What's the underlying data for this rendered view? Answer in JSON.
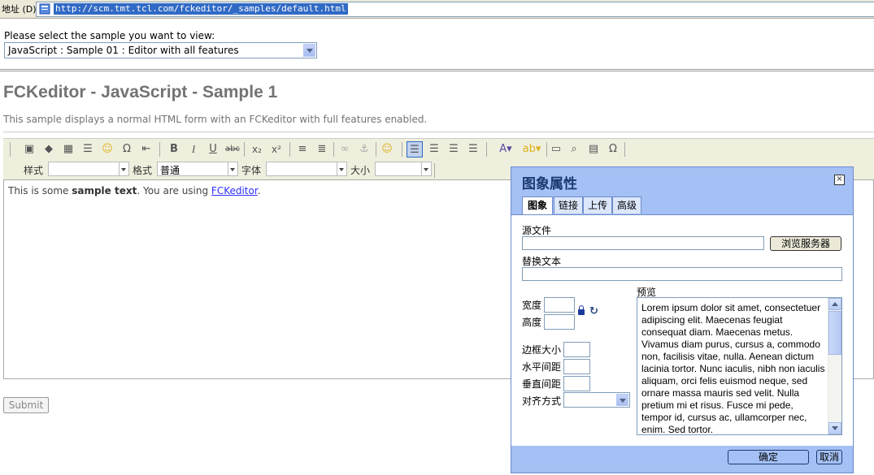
{
  "browser": {
    "address_label": "地址 (D)",
    "url": "http://scm.tmt.tcl.com/fckeditor/_samples/default.html"
  },
  "sample_selector": {
    "label": "Please select the sample you want to view:",
    "selected": "JavaScript : Sample 01 : Editor with all features"
  },
  "page": {
    "title": "FCKeditor - JavaScript - Sample 1",
    "description": "This sample displays a normal HTML form with an FCKeditor with full features enabled."
  },
  "toolbar": {
    "style_label": "样式",
    "format_label": "格式",
    "format_value": "普通",
    "font_label": "字体",
    "size_label": "大小",
    "icons": {
      "bold": "B",
      "italic": "I",
      "underline": "U",
      "strike": "abc",
      "subscript": "x₂",
      "superscript": "x²",
      "omega": "Ω",
      "smiley": "☺"
    }
  },
  "editor": {
    "text_before": "This is some ",
    "text_bold": "sample text",
    "text_middle": ". You are using ",
    "link": "FCKeditor",
    "text_after": "."
  },
  "form": {
    "submit_label": "Submit"
  },
  "dialog": {
    "title": "图象属性",
    "close_glyph": "×",
    "tabs": [
      "图象",
      "链接",
      "上传",
      "高级"
    ],
    "source_label": "源文件",
    "browse_button": "浏览服务器",
    "alt_label": "替换文本",
    "width_label": "宽度",
    "height_label": "高度",
    "border_label": "边框大小",
    "hspace_label": "水平间距",
    "vspace_label": "垂直间距",
    "align_label": "对齐方式",
    "preview_label": "预览",
    "preview_text": "Lorem ipsum dolor sit amet, consectetuer adipiscing elit. Maecenas feugiat consequat diam. Maecenas metus. Vivamus diam purus, cursus a, commodo non, facilisis vitae, nulla. Aenean dictum lacinia tortor. Nunc iaculis, nibh non iaculis aliquam, orci felis euismod neque, sed ornare massa mauris sed velit. Nulla pretium mi et risus. Fusce mi pede, tempor id, cursus ac, ullamcorper nec, enim. Sed tortor.",
    "ok_button": "确定",
    "cancel_button": "取消"
  },
  "colors": {
    "dialog_accent": "#a4c0f4",
    "dialog_title_text": "#1b3a6e",
    "link": "#3030ff",
    "selection": "#316ac5"
  }
}
